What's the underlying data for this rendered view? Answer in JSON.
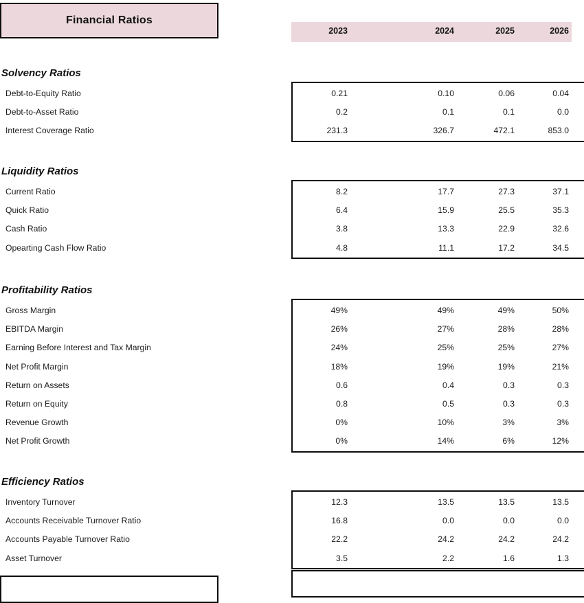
{
  "sheet": {
    "title": "Financial Ratios",
    "accent_color": "#ecd8dc",
    "border_color": "#0d0d0d"
  },
  "columns": {
    "headers": [
      "2023",
      "2024",
      "2025",
      "2026"
    ]
  },
  "sections": [
    {
      "name": "Solvency Ratios",
      "rows": [
        {
          "label": "Debt-to-Equity Ratio",
          "values": [
            "0.21",
            "0.10",
            "0.06",
            "0.04"
          ]
        },
        {
          "label": "Debt-to-Asset Ratio",
          "values": [
            "0.2",
            "0.1",
            "0.1",
            "0.0"
          ]
        },
        {
          "label": "Interest Coverage Ratio",
          "values": [
            "231.3",
            "326.7",
            "472.1",
            "853.0"
          ]
        }
      ]
    },
    {
      "name": "Liquidity Ratios",
      "rows": [
        {
          "label": "Current Ratio",
          "values": [
            "8.2",
            "17.7",
            "27.3",
            "37.1"
          ]
        },
        {
          "label": "Quick Ratio",
          "values": [
            "6.4",
            "15.9",
            "25.5",
            "35.3"
          ]
        },
        {
          "label": "Cash Ratio",
          "values": [
            "3.8",
            "13.3",
            "22.9",
            "32.6"
          ]
        },
        {
          "label": "Opearting Cash Flow Ratio",
          "values": [
            "4.8",
            "11.1",
            "17.2",
            "34.5"
          ]
        }
      ]
    },
    {
      "name": "Profitability Ratios",
      "rows": [
        {
          "label": "Gross Margin",
          "values": [
            "49%",
            "49%",
            "49%",
            "50%"
          ]
        },
        {
          "label": "EBITDA Margin",
          "values": [
            "26%",
            "27%",
            "28%",
            "28%"
          ]
        },
        {
          "label": "Earning Before Interest and Tax Margin",
          "values": [
            "24%",
            "25%",
            "25%",
            "27%"
          ]
        },
        {
          "label": "Net Profit Margin",
          "values": [
            "18%",
            "19%",
            "19%",
            "21%"
          ]
        },
        {
          "label": "Return on Assets",
          "values": [
            "0.6",
            "0.4",
            "0.3",
            "0.3"
          ]
        },
        {
          "label": "Return on Equity",
          "values": [
            "0.8",
            "0.5",
            "0.3",
            "0.3"
          ]
        },
        {
          "label": "Revenue Growth",
          "values": [
            "0%",
            "10%",
            "3%",
            "3%"
          ]
        },
        {
          "label": "Net Profit Growth",
          "values": [
            "0%",
            "14%",
            "6%",
            "12%"
          ]
        }
      ]
    },
    {
      "name": "Efficiency Ratios",
      "rows": [
        {
          "label": "Inventory Turnover",
          "values": [
            "12.3",
            "13.5",
            "13.5",
            "13.5"
          ]
        },
        {
          "label": "Accounts Receivable Turnover Ratio",
          "values": [
            "16.8",
            "0.0",
            "0.0",
            "0.0"
          ]
        },
        {
          "label": "Accounts Payable Turnover Ratio",
          "values": [
            "22.2",
            "24.2",
            "24.2",
            "24.2"
          ]
        },
        {
          "label": "Asset Turnover",
          "values": [
            "3.5",
            "2.2",
            "1.6",
            "1.3"
          ]
        }
      ]
    }
  ]
}
